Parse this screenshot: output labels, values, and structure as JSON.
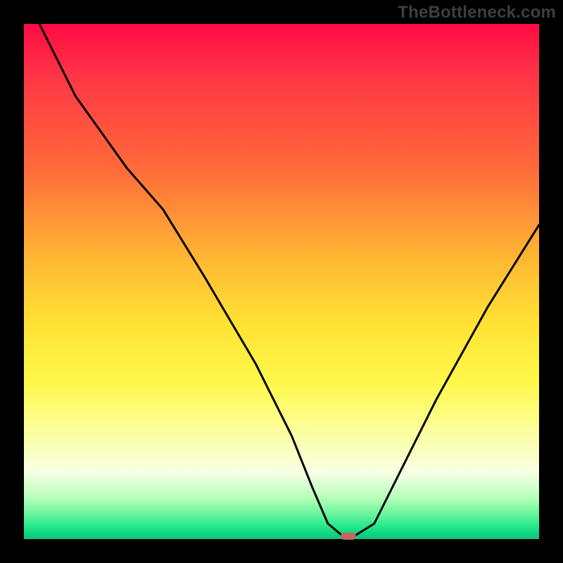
{
  "watermark": "TheBottleneck.com",
  "colors": {
    "page_bg": "#000000",
    "curve_stroke": "#000000",
    "marker_fill": "#c4655e",
    "watermark_color": "#3e3e3e"
  },
  "chart_data": {
    "type": "line",
    "title": "",
    "xlabel": "",
    "ylabel": "",
    "xlim": [
      0,
      100
    ],
    "ylim": [
      0,
      100
    ],
    "x": [
      3,
      10,
      20,
      27,
      35,
      45,
      52,
      56,
      59,
      62,
      64,
      68,
      72,
      80,
      90,
      100
    ],
    "values": [
      100,
      86,
      72,
      64,
      51,
      34,
      20,
      10,
      3,
      0.5,
      0.5,
      3,
      11,
      27,
      45,
      61
    ],
    "marker": {
      "x": 63,
      "y": 0.5
    },
    "gradient_stops": [
      {
        "pos": 0,
        "color": "#ff0a44"
      },
      {
        "pos": 0.1,
        "color": "#ff3545"
      },
      {
        "pos": 0.28,
        "color": "#ff6a3a"
      },
      {
        "pos": 0.45,
        "color": "#ffb533"
      },
      {
        "pos": 0.58,
        "color": "#ffe234"
      },
      {
        "pos": 0.7,
        "color": "#fff94c"
      },
      {
        "pos": 0.8,
        "color": "#fbffa5"
      },
      {
        "pos": 0.87,
        "color": "#f8ffe4"
      },
      {
        "pos": 0.92,
        "color": "#b6ffb9"
      },
      {
        "pos": 0.95,
        "color": "#6cf59e"
      },
      {
        "pos": 0.975,
        "color": "#27e88c"
      },
      {
        "pos": 0.99,
        "color": "#0fd37e"
      },
      {
        "pos": 1.0,
        "color": "#13c185"
      }
    ]
  }
}
